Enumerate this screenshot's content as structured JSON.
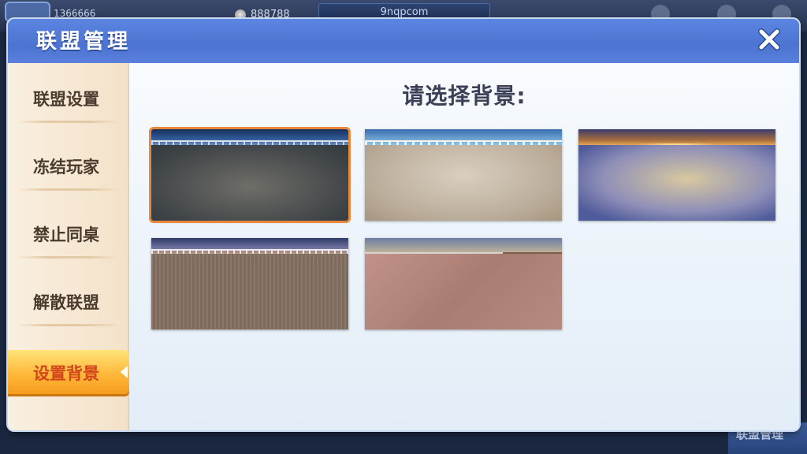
{
  "background": {
    "player_id": "1366666",
    "coins": "888788",
    "site": "9nqpcom",
    "bottom_button": "联盟管理"
  },
  "dialog": {
    "title": "联盟管理",
    "close_icon": "close-icon"
  },
  "sidebar": {
    "items": [
      {
        "label": "联盟设置",
        "active": false
      },
      {
        "label": "冻结玩家",
        "active": false
      },
      {
        "label": "禁止同桌",
        "active": false
      },
      {
        "label": "解散联盟",
        "active": false
      },
      {
        "label": "设置背景",
        "active": true
      }
    ]
  },
  "content": {
    "heading": "请选择背景:",
    "backgrounds": [
      {
        "name": "night-harbor-terrace",
        "selected": true
      },
      {
        "name": "seaside-balcony",
        "selected": false
      },
      {
        "name": "grand-hall",
        "selected": false
      },
      {
        "name": "city-night-deck",
        "selected": false
      },
      {
        "name": "skyline-rooftop",
        "selected": false
      }
    ]
  },
  "colors": {
    "title_bar": "#4c73d1",
    "active_tab": "#ffb83a",
    "active_tab_text": "#d2451a",
    "selected_border": "#e9883b"
  }
}
